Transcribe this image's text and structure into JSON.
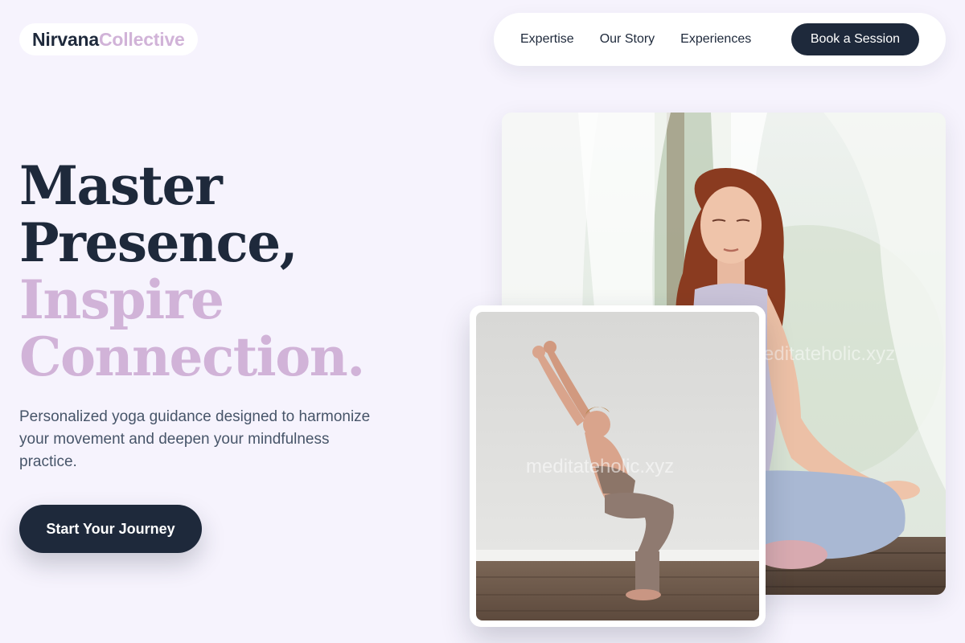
{
  "brand": {
    "part1": "Nirvana",
    "part2": "Collective"
  },
  "nav": {
    "links": [
      "Expertise",
      "Our Story",
      "Experiences"
    ],
    "cta": "Book a Session"
  },
  "hero": {
    "headline_dark": [
      "Master",
      "Presence,"
    ],
    "headline_light": [
      "Inspire",
      "Connection."
    ],
    "subtext": "Personalized yoga guidance designed to harmonize your movement and deepen your mindfulness practice.",
    "cta": "Start Your Journey"
  },
  "images": {
    "main": {
      "watermark": "meditateholic.xyz",
      "alt": "woman-meditating-photo"
    },
    "secondary": {
      "watermark": "meditateholic.xyz",
      "alt": "woman-chair-pose-photo"
    }
  },
  "colors": {
    "background": "#f6f3fd",
    "dark": "#1e293b",
    "accent": "#d1b3d8",
    "body_text": "#475569"
  }
}
